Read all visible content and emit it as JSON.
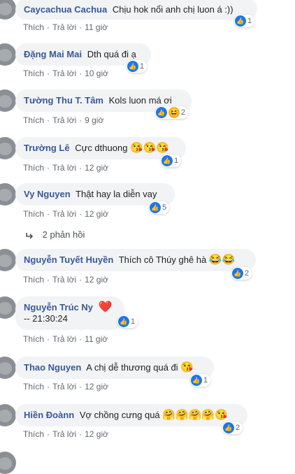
{
  "comments": [
    {
      "name": "Caycachua Cachua",
      "text": "Chịu hok nổi anh chị luon á :))",
      "like": "Thích",
      "reply": "Trả lời",
      "time": "11 giờ",
      "count": "1",
      "reaction": "like"
    },
    {
      "name": "Đặng Mai Mai",
      "text": "Dth quá đi ạ",
      "like": "Thích",
      "reply": "Trả lời",
      "time": "10 giờ",
      "count": "1",
      "reaction": "like"
    },
    {
      "name": "Tường Thu T. Tâm",
      "text": "Kols luon má ơi",
      "like": "Thích",
      "reply": "Trả lời",
      "time": "9 giờ",
      "count": "2",
      "reaction": "like-haha"
    },
    {
      "name": "Trường Lê",
      "text": "Cực dthuong",
      "emoji": "😘😘😘",
      "like": "Thích",
      "reply": "Trả lời",
      "time": "12 giờ",
      "count": "1",
      "reaction": "like"
    },
    {
      "name": "Vy Nguyen",
      "text": "Thật hay la diễn vay",
      "like": "Thích",
      "reply": "Trả lời",
      "time": "12 giờ",
      "count": "5",
      "reaction": "like"
    },
    {
      "name": "Nguyễn Tuyết Huyền",
      "text": "Thích cô Thúy ghê hà",
      "emoji": "😂😂",
      "like": "Thích",
      "reply": "Trả lời",
      "time": "12 giờ",
      "count": "2",
      "reaction": "like"
    },
    {
      "name": "Nguyễn Trúc Ny",
      "text": "-- 21:30:24",
      "emoji": "❤️",
      "like": "Thích",
      "reply": "Trả lời",
      "time": "11 giờ",
      "count": "1",
      "reaction": "like"
    },
    {
      "name": "Thao Nguyen",
      "text": "A chị dễ thương quá đi",
      "emoji": "😘",
      "like": "Thích",
      "reply": "Trả lời",
      "time": "12 giờ",
      "count": "1",
      "reaction": "like"
    },
    {
      "name": "Hiền Đoànn",
      "text": "Vợ chồng cưng quá",
      "emoji": "🤗🤗🤗🤗😘",
      "like": "Thích",
      "reply": "Trả lời",
      "time": "12 giờ",
      "count": "2",
      "reaction": "like"
    }
  ],
  "replies_label": "2 phản hồi",
  "dot": "·",
  "thumb_icon": "👍",
  "haha_icon": "😆"
}
